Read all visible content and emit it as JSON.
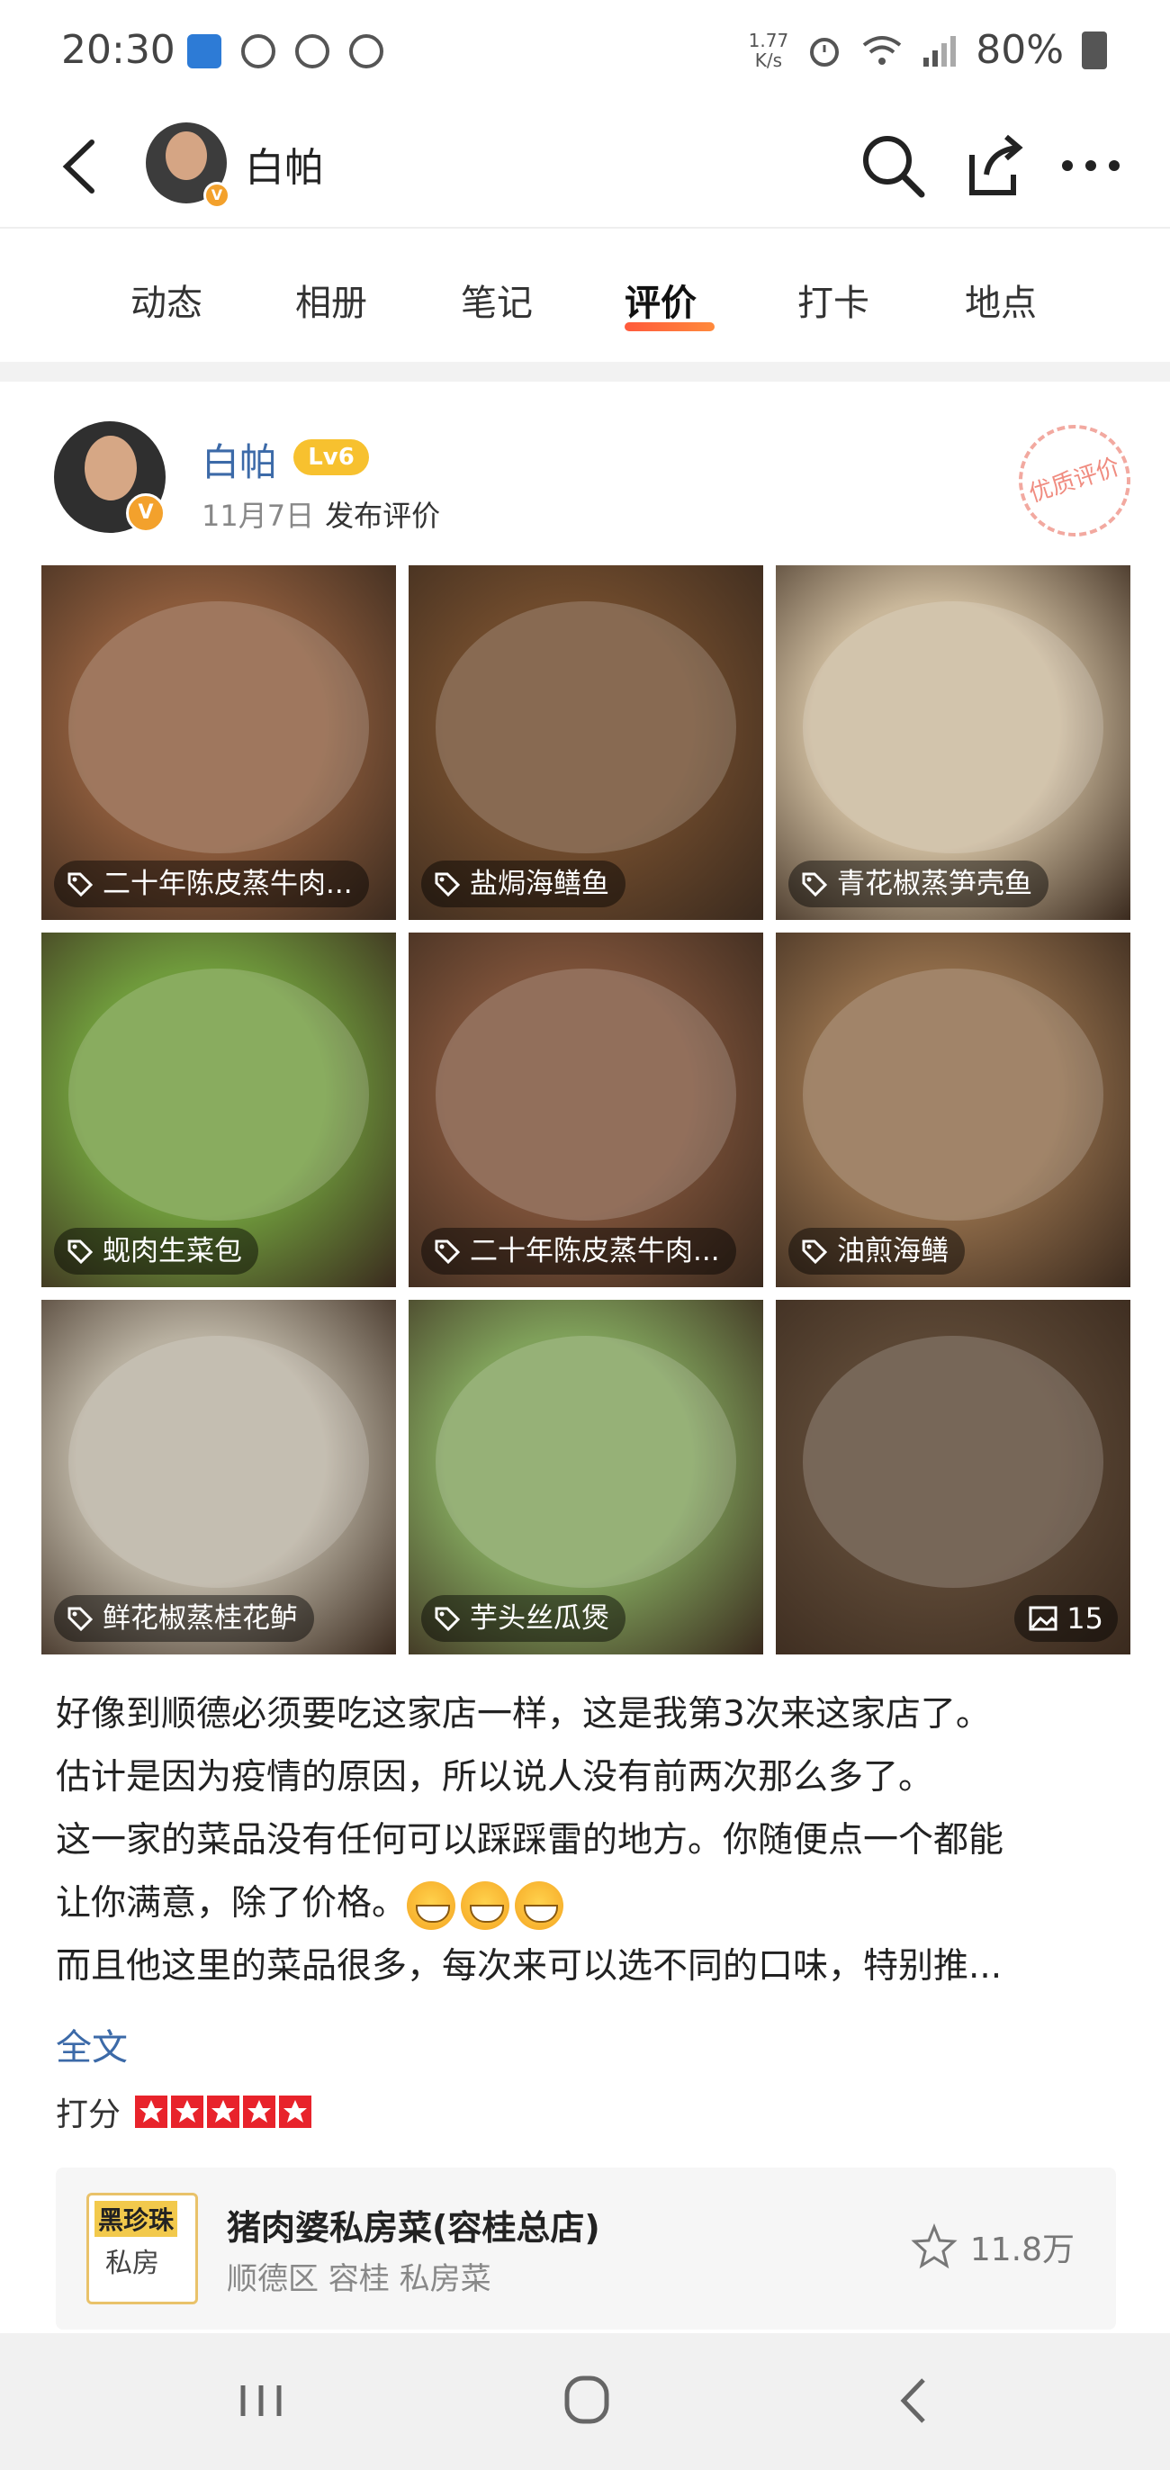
{
  "status_bar": {
    "time": "20:30",
    "net_speed_value": "1.77",
    "net_speed_unit": "K/s",
    "battery": "80%"
  },
  "header": {
    "username": "白帕",
    "icons": [
      "back-icon",
      "search-icon",
      "share-icon",
      "more-icon"
    ]
  },
  "tabs": [
    {
      "label": "动态"
    },
    {
      "label": "相册"
    },
    {
      "label": "笔记"
    },
    {
      "label": "评价",
      "active": true
    },
    {
      "label": "打卡"
    },
    {
      "label": "地点"
    }
  ],
  "post": {
    "author": "白帕",
    "level": "Lv6",
    "date": "11月7日",
    "action": "发布评价",
    "stamp": "优质评价",
    "photos": [
      {
        "tag": "二十年陈皮蒸牛肉...",
        "color": "#8a5a3b"
      },
      {
        "tag": "盐焗海鳝鱼",
        "color": "#6e4a2c"
      },
      {
        "tag": "青花椒蒸笋壳鱼",
        "color": "#c9b79a"
      },
      {
        "tag": "蚬肉生菜包",
        "color": "#6f9a3c"
      },
      {
        "tag": "二十年陈皮蒸牛肉...",
        "color": "#7a5038"
      },
      {
        "tag": "油煎海鳝",
        "color": "#8d6a48"
      },
      {
        "tag": "鲜花椒蒸桂花鲈",
        "color": "#b8b0a0"
      },
      {
        "tag": "芋头丝瓜煲",
        "color": "#7fa05a"
      },
      {
        "tag": "",
        "color": "#5a4634"
      }
    ],
    "photo_more_count": "15",
    "body_lines": [
      "好像到顺德必须要吃这家店一样，这是我第3次来这家店了。",
      "估计是因为疫情的原因，所以说人没有前两次那么多了。",
      "这一家的菜品没有任何可以踩踩雷的地方。你随便点一个都能",
      "让你满意，除了价格。",
      "而且他这里的菜品很多，每次来可以选不同的口味，特别推..."
    ],
    "full_text_link": "全文",
    "rating_label": "打分",
    "rating_stars": 5,
    "shop": {
      "logo_text_1": "黑珍珠",
      "logo_text_2": "私房",
      "name": "猪肉婆私房菜(容桂总店)",
      "subtitle": "顺德区 容桂 私房菜",
      "favorites": "11.8万"
    }
  },
  "nav_bar": {
    "icons": [
      "recent-apps-icon",
      "home-icon",
      "back-nav-icon"
    ]
  }
}
